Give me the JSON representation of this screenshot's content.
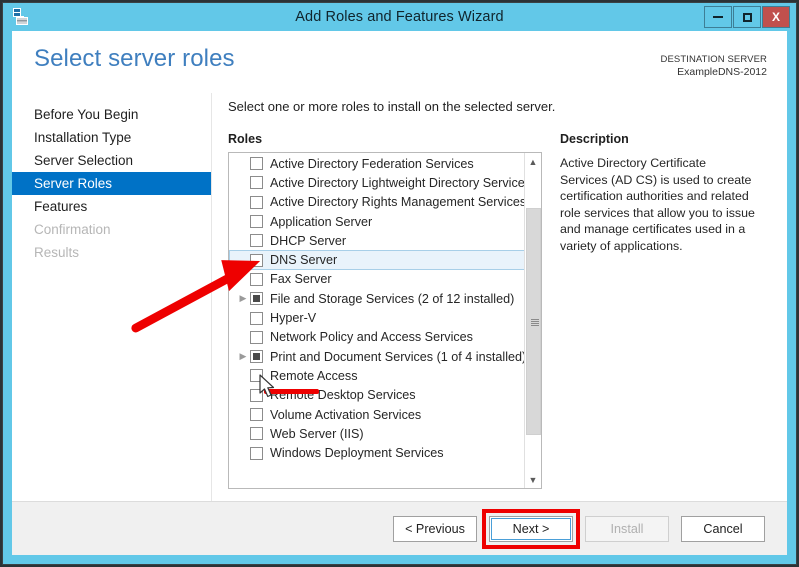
{
  "window": {
    "title": "Add Roles and Features Wizard",
    "icon": "server-wizard-icon",
    "minimize_label": "Minimize",
    "maximize_label": "Maximize",
    "close_label": "X"
  },
  "header": {
    "page_title": "Select server roles",
    "destination_label": "DESTINATION SERVER",
    "destination_name": "ExampleDNS-2012"
  },
  "nav": {
    "items": [
      {
        "label": "Before You Begin",
        "state": "normal"
      },
      {
        "label": "Installation Type",
        "state": "normal"
      },
      {
        "label": "Server Selection",
        "state": "normal"
      },
      {
        "label": "Server Roles",
        "state": "active"
      },
      {
        "label": "Features",
        "state": "normal"
      },
      {
        "label": "Confirmation",
        "state": "disabled"
      },
      {
        "label": "Results",
        "state": "disabled"
      }
    ]
  },
  "main": {
    "instruction": "Select one or more roles to install on the selected server.",
    "roles_heading": "Roles",
    "roles": [
      {
        "label": "Active Directory Federation Services",
        "checkbox": "empty",
        "expandable": false,
        "selected": false
      },
      {
        "label": "Active Directory Lightweight Directory Services",
        "checkbox": "empty",
        "expandable": false,
        "selected": false
      },
      {
        "label": "Active Directory Rights Management Services",
        "checkbox": "empty",
        "expandable": false,
        "selected": false
      },
      {
        "label": "Application Server",
        "checkbox": "empty",
        "expandable": false,
        "selected": false
      },
      {
        "label": "DHCP Server",
        "checkbox": "empty",
        "expandable": false,
        "selected": false
      },
      {
        "label": "DNS Server",
        "checkbox": "empty",
        "expandable": false,
        "selected": true
      },
      {
        "label": "Fax Server",
        "checkbox": "empty",
        "expandable": false,
        "selected": false
      },
      {
        "label": "File and Storage Services (2 of 12 installed)",
        "checkbox": "partial",
        "expandable": true,
        "selected": false
      },
      {
        "label": "Hyper-V",
        "checkbox": "empty",
        "expandable": false,
        "selected": false
      },
      {
        "label": "Network Policy and Access Services",
        "checkbox": "empty",
        "expandable": false,
        "selected": false
      },
      {
        "label": "Print and Document Services (1 of 4 installed)",
        "checkbox": "partial",
        "expandable": true,
        "selected": false
      },
      {
        "label": "Remote Access",
        "checkbox": "empty",
        "expandable": false,
        "selected": false
      },
      {
        "label": "Remote Desktop Services",
        "checkbox": "empty",
        "expandable": false,
        "selected": false
      },
      {
        "label": "Volume Activation Services",
        "checkbox": "empty",
        "expandable": false,
        "selected": false
      },
      {
        "label": "Web Server (IIS)",
        "checkbox": "empty",
        "expandable": false,
        "selected": false
      },
      {
        "label": "Windows Deployment Services",
        "checkbox": "empty",
        "expandable": false,
        "selected": false
      }
    ],
    "description_heading": "Description",
    "description_text": "Active Directory Certificate Services (AD CS) is used to create certification authorities and related role services that allow you to issue and manage certificates used in a variety of applications."
  },
  "footer": {
    "previous_label": "< Previous",
    "next_label": "Next >",
    "install_label": "Install",
    "cancel_label": "Cancel"
  },
  "annotations": {
    "arrow_color": "#ee0000",
    "highlight_color": "#ee0000",
    "arrow_target": "dns-server-checkbox",
    "highlight_target": "next-button"
  },
  "colors": {
    "titlebar": "#62c8e8",
    "accent": "#0072c6",
    "page_title": "#3f7fbf",
    "close_button": "#c0504d",
    "selection": "#e9f3fb"
  }
}
